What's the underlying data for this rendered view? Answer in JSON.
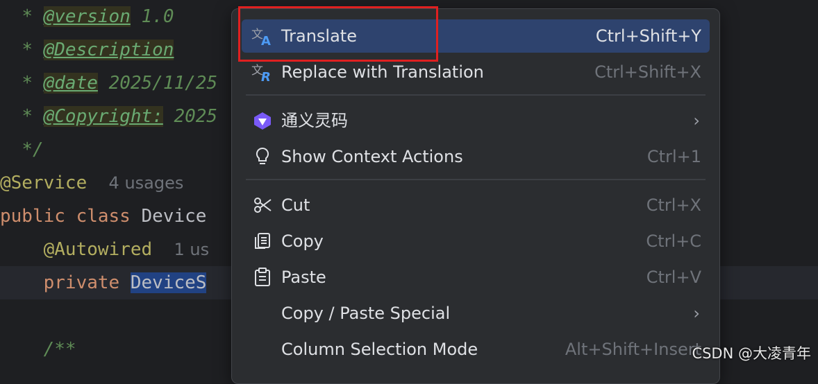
{
  "editor": {
    "lines": {
      "version_tag": "@version",
      "version_val": "1.0",
      "description_tag": "@Description",
      "date_tag": "@date",
      "date_val": "2025/11/25",
      "copyright_tag": "@Copyright:",
      "copyright_val": "2025",
      "comment_star": "*",
      "comment_end": "*/",
      "service_ann": "@Service",
      "service_hint": "4 usages",
      "public_kw": "public class",
      "class_name": "Device",
      "autowired_ann": "@Autowired",
      "autowired_hint": "1 us",
      "private_kw": "private",
      "private_type": "DeviceS",
      "javadoc_start": "/**"
    }
  },
  "context_menu": {
    "items": [
      {
        "label": "Translate",
        "shortcut": "Ctrl+Shift+Y",
        "icon": "translate-icon"
      },
      {
        "label": "Replace with Translation",
        "shortcut": "Ctrl+Shift+X",
        "icon": "replace-translation-icon"
      },
      {
        "label": "通义灵码",
        "icon": "tongyi-lingma-icon"
      },
      {
        "label": "Show Context Actions",
        "shortcut": "Ctrl+1",
        "icon": "lightbulb-icon"
      },
      {
        "label": "Cut",
        "shortcut": "Ctrl+X",
        "icon": "scissors-icon"
      },
      {
        "label": "Copy",
        "shortcut": "Ctrl+C",
        "icon": "copy-icon"
      },
      {
        "label": "Paste",
        "shortcut": "Ctrl+V",
        "icon": "paste-icon"
      },
      {
        "label": "Copy / Paste Special"
      },
      {
        "label": "Column Selection Mode",
        "shortcut": "Alt+Shift+Insert"
      }
    ]
  },
  "watermark": "CSDN @大凌青年",
  "colors": {
    "background": "#1e1f22",
    "menu_bg": "#2b2d30",
    "menu_active": "#2e436e",
    "highlight_box": "#e02020"
  }
}
